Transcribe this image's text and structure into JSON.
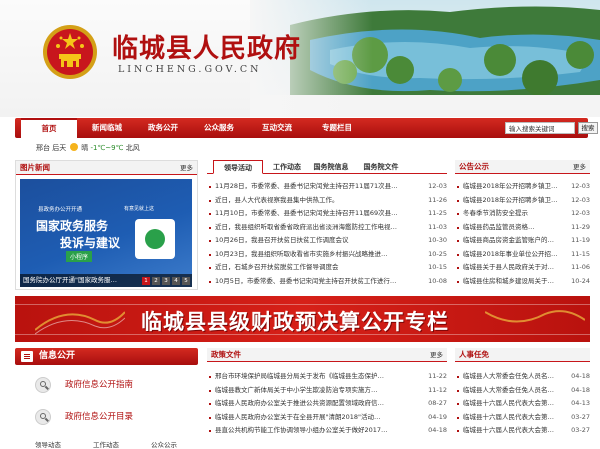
{
  "header": {
    "title": "临城县人民政府",
    "domain": "LINCHENG.GOV.CN"
  },
  "nav": {
    "items": [
      "首页",
      "新闻临城",
      "政务公开",
      "公众服务",
      "互动交流",
      "专题栏目"
    ],
    "active_index": 0,
    "search_placeholder": "输入搜索关键词",
    "search_button": "搜索"
  },
  "weather": {
    "location": "邢台 后天",
    "condition": "晴",
    "temperature": "-1℃~9℃",
    "wind": "北风"
  },
  "photo_news": {
    "title": "图片新闻",
    "more": "更多",
    "poster_small": "县政务办公开开通",
    "poster_line1": "国家政务服务",
    "poster_line2": "投诉与建议",
    "poster_tag": "小程序",
    "poster_qr_label": "有意见就上这",
    "caption": "国务院办公厅开通\"国家政务服…",
    "pages": [
      "1",
      "2",
      "3",
      "4",
      "5"
    ],
    "active_page": 0
  },
  "news": {
    "tabs": [
      "领导活动",
      "工作动态",
      "国务院信息",
      "国务院文件"
    ],
    "active_tab": 0,
    "items": [
      {
        "title": "11月28日，市委常委、县委书记宋闰党主持召开11届71次县…",
        "date": "12-03"
      },
      {
        "title": "近日，县人大代表视察我县集中供热工作。",
        "date": "11-26"
      },
      {
        "title": "11月10日，市委常委、县委书记宋闰党主持召开11届69次县…",
        "date": "11-25"
      },
      {
        "title": "近日，我县组织听取省委省政府派出省淡洲海鑑防控工作电视…",
        "date": "11-03"
      },
      {
        "title": "10月26日，我县召开扶贫日扶贫工作调度会议",
        "date": "10-30"
      },
      {
        "title": "10月23日，我县组织听取收看省市实施乡村振兴战略推进…",
        "date": "10-25"
      },
      {
        "title": "近日，石城乡召开扶贫脱贫工作督导调度会",
        "date": "10-15"
      },
      {
        "title": "10月5日，市委常委、县委书记宋闰党主持召开扶贫工作进行…",
        "date": "10-08"
      }
    ]
  },
  "notice": {
    "title": "公告公示",
    "more": "更多",
    "items": [
      {
        "title": "临城县2018年公开招聘乡镇卫…",
        "date": "12-03"
      },
      {
        "title": "临城县2018年公开招聘乡镇卫…",
        "date": "12-03"
      },
      {
        "title": "冬春季节消防安全提示",
        "date": "12-03"
      },
      {
        "title": "临城县药品监管员资格…",
        "date": "11-29"
      },
      {
        "title": "临城县商品房资金监管账户的…",
        "date": "11-19"
      },
      {
        "title": "临城县2018年事业单位公开招…",
        "date": "11-15"
      },
      {
        "title": "临城县关于县人民政府关于对…",
        "date": "11-06"
      },
      {
        "title": "临城县住房和城乡建设局关于…",
        "date": "10-24"
      }
    ]
  },
  "finance_banner": {
    "text": "临城县县级财政预决算公开专栏"
  },
  "info": {
    "title": "信息公开",
    "links": [
      "政府信息公开指南",
      "政府信息公开目录"
    ],
    "tabs": [
      "领导动态",
      "工作动态",
      "公众公示"
    ]
  },
  "policy": {
    "title": "政策文件",
    "more": "更多",
    "items": [
      {
        "title": "邢台市环境保护局临城县分局关于发布《临城县生态保护…",
        "date": "11-22"
      },
      {
        "title": "临城县教文广新体局关于中小学生欺凌防治专项实施方…",
        "date": "11-12"
      },
      {
        "title": "临城县人民政府办公室关于推进公共资源配置领域政府信…",
        "date": "08-27"
      },
      {
        "title": "临城县人民政府办公室关于在全县开展\"清朗2018\"活动…",
        "date": "04-19"
      },
      {
        "title": "县直公共机构节能工作协调领导小组办公室关于做好2017…",
        "date": "04-18"
      }
    ]
  },
  "personnel": {
    "title": "人事任免",
    "items": [
      {
        "title": "临城县人大常委会任免人员名…",
        "date": "04-18"
      },
      {
        "title": "临城县人大常委会任免人员名…",
        "date": "04-18"
      },
      {
        "title": "临城县十六届人民代表大会第…",
        "date": "04-13"
      },
      {
        "title": "临城县十六届人民代表大会第…",
        "date": "03-27"
      },
      {
        "title": "临城县十六届人民代表大会第…",
        "date": "03-27"
      }
    ]
  }
}
